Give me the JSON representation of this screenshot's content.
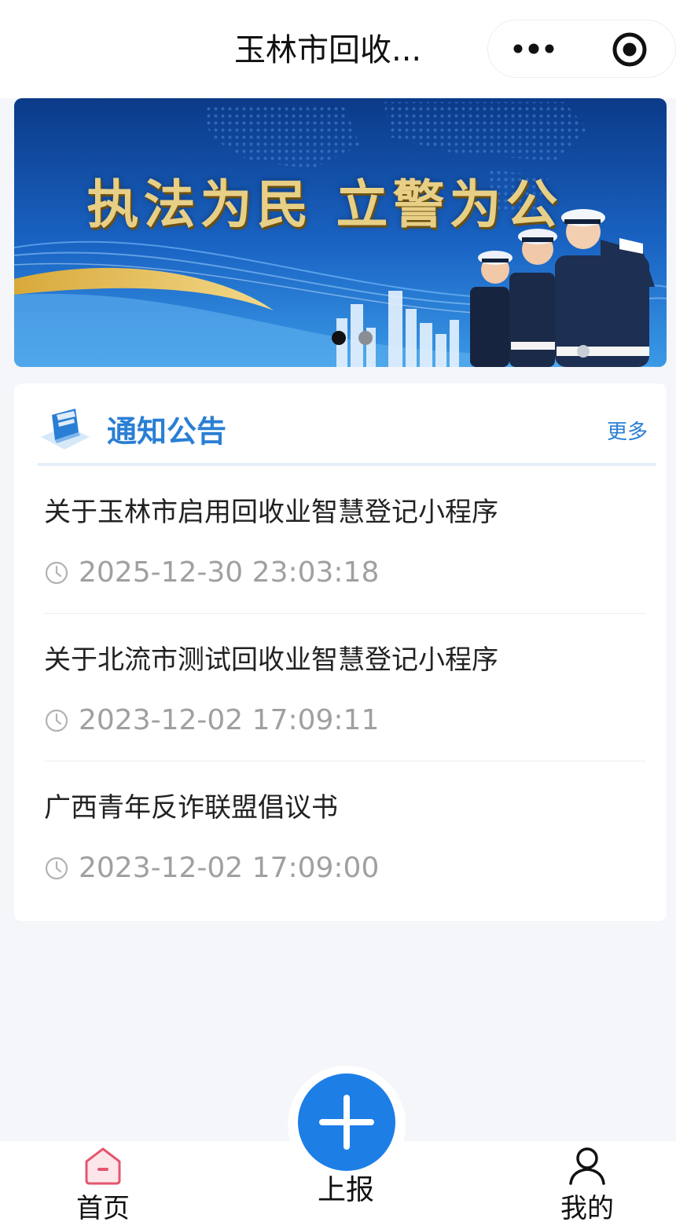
{
  "navbar": {
    "title": "玉林市回收...",
    "more_icon": "more-dots-icon",
    "close_icon": "target-circle-icon"
  },
  "banner": {
    "slogan": "执法为民 立警为公",
    "slide_index": 1,
    "slide_count": 2,
    "colors": {
      "bg_top": "#0b3e8f",
      "bg_bottom": "#2d8fe0",
      "gold": "#e8cf86"
    }
  },
  "notices": {
    "title": "通知公告",
    "more_label": "更多",
    "accent_color": "#2a7fd4",
    "items": [
      {
        "title": "关于玉林市启用回收业智慧登记小程序",
        "time": "2025-12-30 23:03:18"
      },
      {
        "title": "关于北流市测试回收业智慧登记小程序",
        "time": "2023-12-02 17:09:11"
      },
      {
        "title": "广西青年反诈联盟倡议书",
        "time": "2023-12-02 17:09:00"
      }
    ]
  },
  "tabbar": {
    "home_label": "首页",
    "home_icon": "home-icon",
    "report_label": "上报",
    "report_icon": "plus-icon",
    "report_color": "#1d7ee6",
    "mine_label": "我的",
    "mine_icon": "user-icon"
  }
}
